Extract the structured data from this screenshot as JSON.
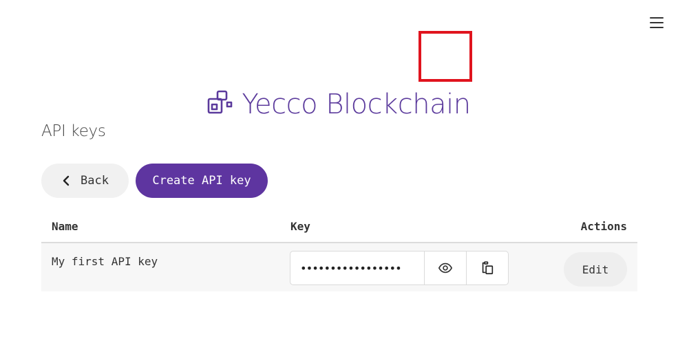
{
  "header": {
    "brand_name": "Yecco Blockchain",
    "brand_color": "#5b3a9c",
    "logo_icon": "blocks-logo-icon",
    "menu_icon": "hamburger-menu-icon"
  },
  "page": {
    "title": "API keys"
  },
  "toolbar": {
    "back_label": "Back",
    "back_icon": "chevron-left-icon",
    "create_label": "Create API key",
    "create_color": "#5e35a0"
  },
  "table": {
    "columns": [
      "Name",
      "Key",
      "Actions"
    ],
    "rows": [
      {
        "name": "My first API key",
        "key_masked": "•••••••••••••••••",
        "reveal_icon": "eye-icon",
        "copy_icon": "clipboard-copy-icon",
        "action_label": "Edit"
      }
    ]
  },
  "annotation": {
    "highlight_color": "#e0141e",
    "highlight_target": "copy-key-button"
  }
}
